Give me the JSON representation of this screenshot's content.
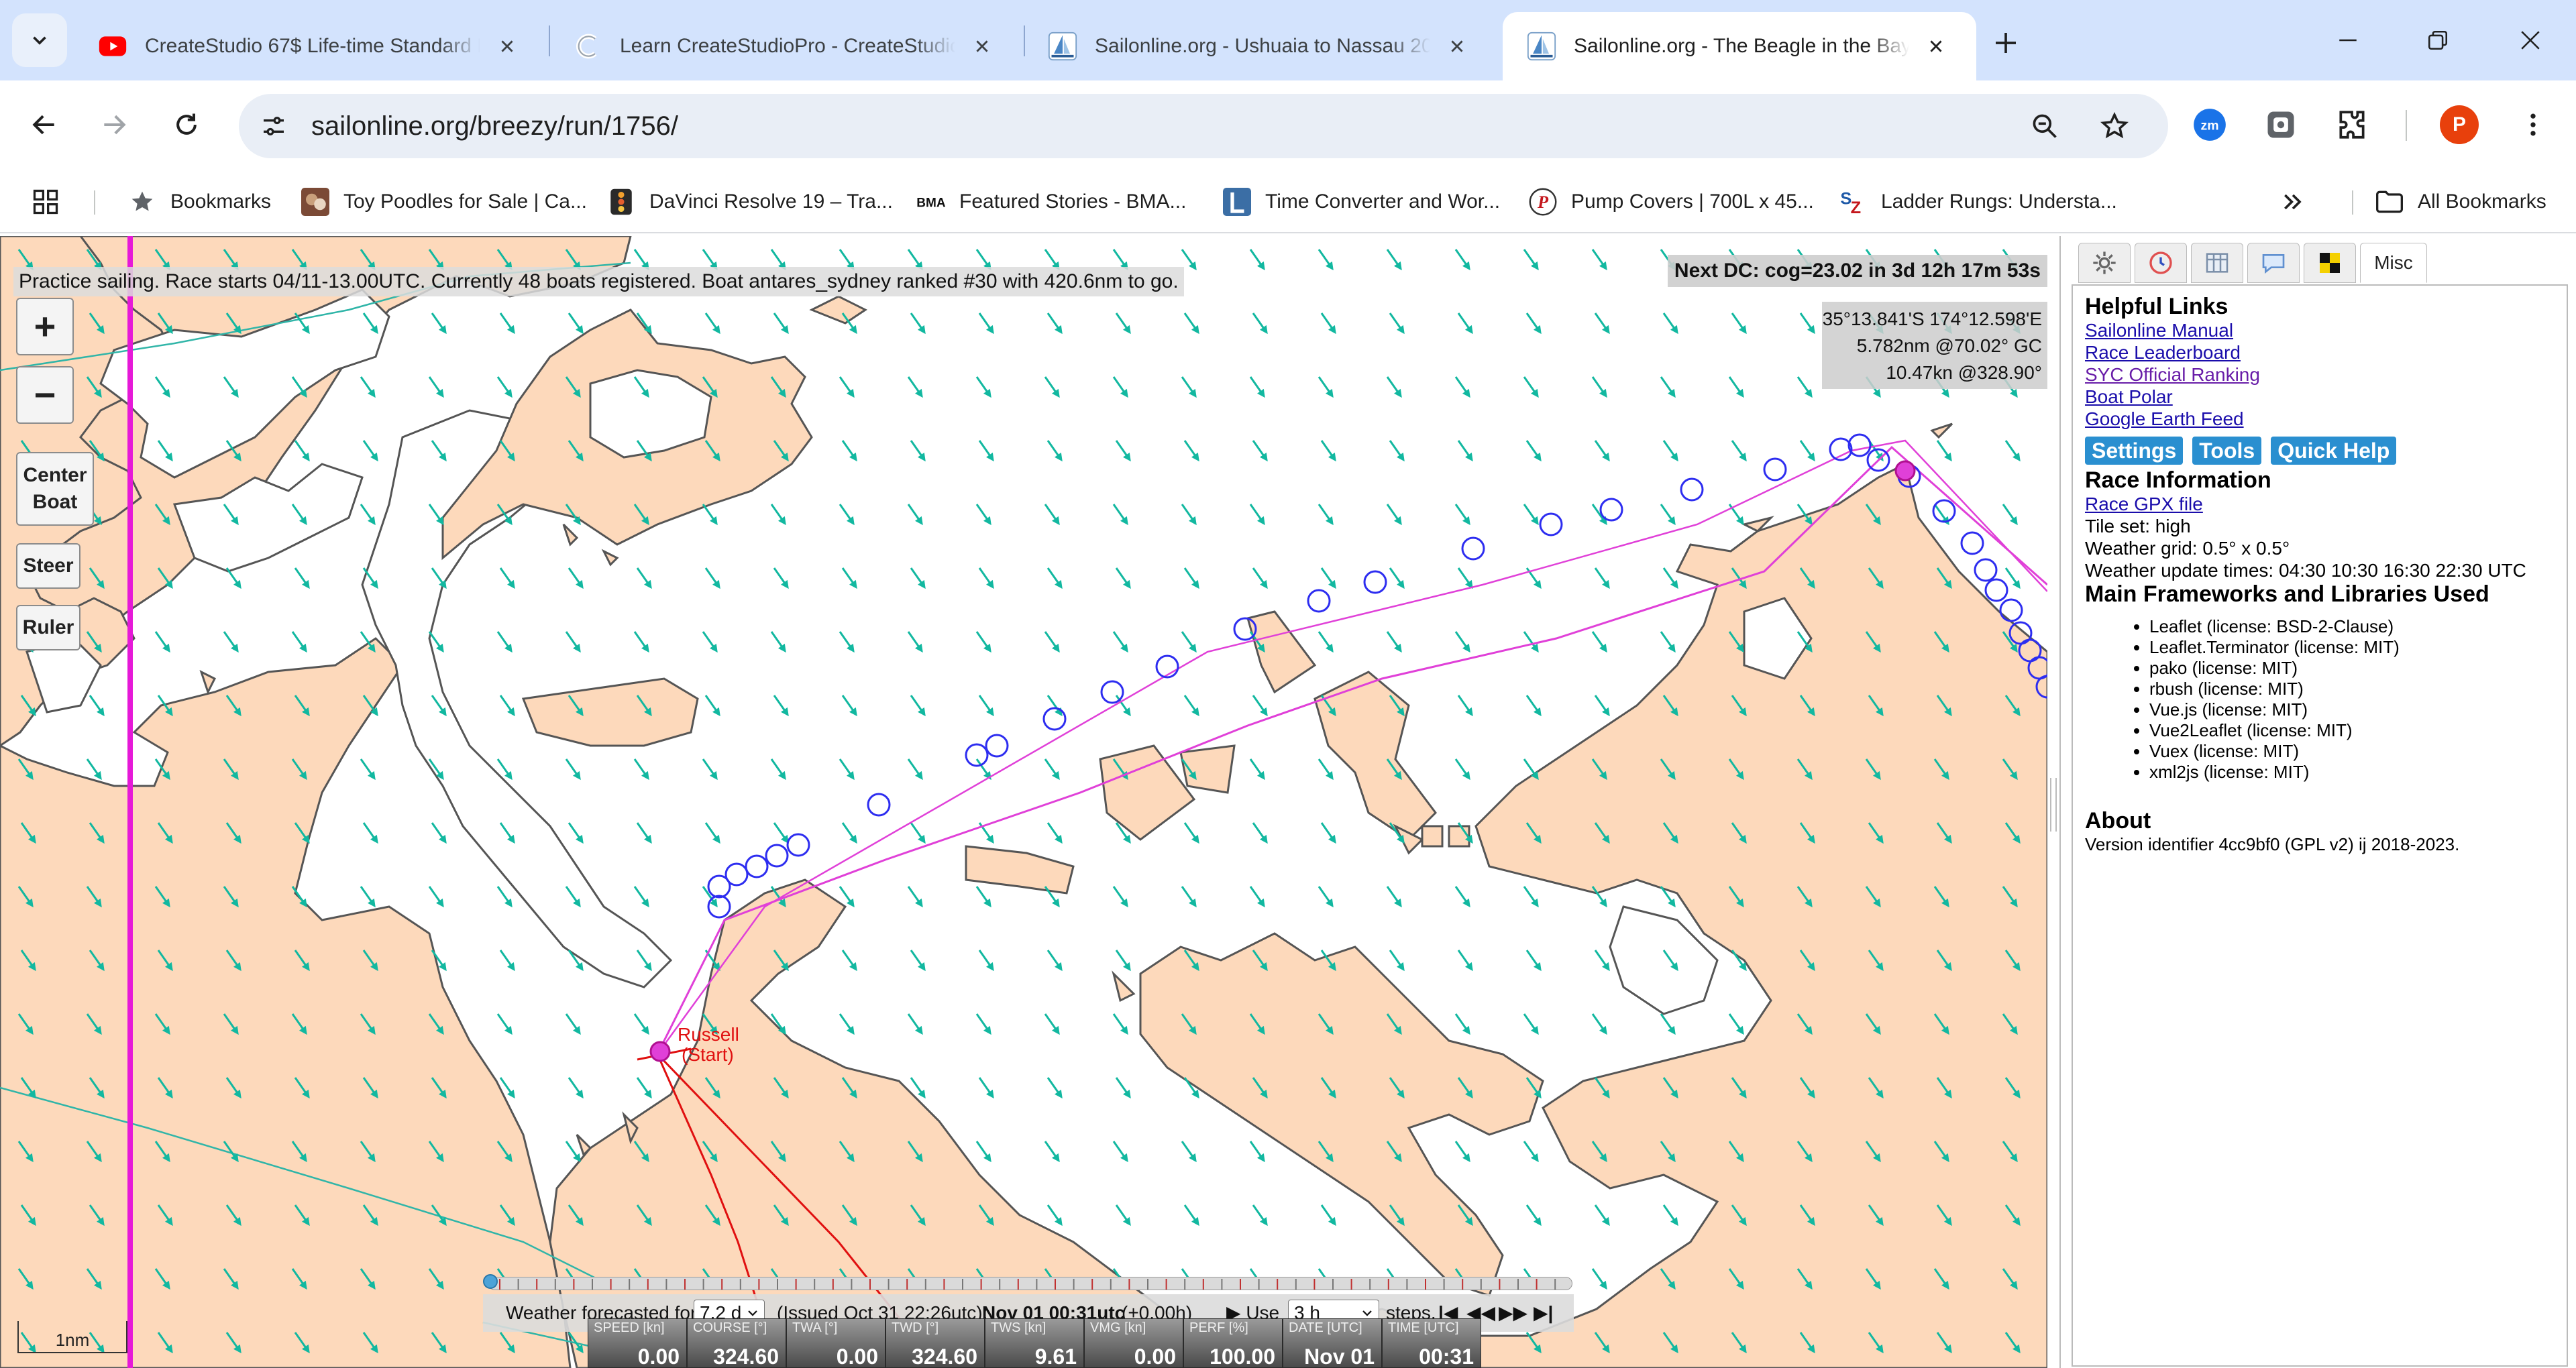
{
  "browser": {
    "tabs": [
      {
        "title": "CreateStudio 67$ Life-time Standard P",
        "favicon": "youtube-icon"
      },
      {
        "title": "Learn CreateStudioPro - CreateStudio",
        "favicon": "createstudio-icon"
      },
      {
        "title": "Sailonline.org - Ushuaia to Nassau 20",
        "favicon": "sailonline-icon"
      },
      {
        "title": "Sailonline.org - The Beagle in the Bay",
        "favicon": "sailonline-icon",
        "active": true
      }
    ],
    "url": "sailonline.org/breezy/run/1756/",
    "profile_initial": "P",
    "extensions": [
      "zoom-extension-icon",
      "extension-icon",
      "puzzle-icon"
    ]
  },
  "bookmarks": {
    "items": [
      {
        "label": "Bookmarks",
        "icon": "star-icon"
      },
      {
        "label": "Toy Poodles for Sale | Ca...",
        "icon": "poodle-icon"
      },
      {
        "label": "DaVinci Resolve 19 – Tra...",
        "icon": "davinci-icon"
      },
      {
        "label": "Featured Stories - BMA...",
        "icon": "bma-icon"
      },
      {
        "label": "Time Converter and Wor...",
        "icon": "clock-icon"
      },
      {
        "label": "Pump Covers | 700L x 45...",
        "icon": "pump-icon"
      },
      {
        "label": "Ladder Rungs: Understa...",
        "icon": "sz-icon"
      }
    ],
    "all_label": "All Bookmarks"
  },
  "map": {
    "status": "Practice sailing. Race starts 04/11-13.00UTC. Currently 48 boats registered. Boat antares_sydney ranked #30 with 420.6nm to go.",
    "next_dc": "Next DC: cog=23.02 in 3d 12h 17m 53s",
    "coords": [
      "35°13.841'S 174°12.598'E",
      "5.782nm @70.02° GC",
      "10.47kn @328.90°"
    ],
    "controls": {
      "zoom_in": "+",
      "zoom_out": "−",
      "center_boat": "Center Boat",
      "steer": "Steer",
      "ruler": "Ruler"
    },
    "start_label": [
      "Russell",
      "(Start)"
    ],
    "scale": "1nm",
    "colors": {
      "land": "#fdd9bb",
      "water": "#ffffff",
      "wind_arrow": "#12b8a0",
      "route": "#e040d8",
      "waypoint": "#2d2df0",
      "track": "#e01010"
    }
  },
  "forecast": {
    "label": "Weather forecasted for",
    "range": "7.2 d",
    "issued": "(Issued Oct 31 22:26utc):",
    "time": "Nov 01 00:31utc",
    "offset": "(+0.00h)",
    "use_label": "▶ Use",
    "step": "3 h",
    "steps_label": "steps.",
    "transport": [
      "|◀",
      "◀◀",
      "▶▶",
      "▶|"
    ]
  },
  "instruments": [
    {
      "label": "SPEED [kn]",
      "value": "0.00"
    },
    {
      "label": "COURSE [°]",
      "value": "324.60"
    },
    {
      "label": "TWA [°]",
      "value": "0.00"
    },
    {
      "label": "TWD [°]",
      "value": "324.60"
    },
    {
      "label": "TWS [kn]",
      "value": "9.61"
    },
    {
      "label": "VMG [kn]",
      "value": "0.00"
    },
    {
      "label": "PERF [%]",
      "value": "100.00"
    },
    {
      "label": "DATE [UTC]",
      "value": "Nov 01"
    },
    {
      "label": "TIME [UTC]",
      "value": "00:31"
    }
  ],
  "panel": {
    "tabs": [
      "weather-icon",
      "clock-icon",
      "fleet-icon",
      "chat-icon",
      "flag-icon"
    ],
    "active_tab": "Misc",
    "helpful_title": "Helpful Links",
    "links": [
      "Sailonline Manual",
      "Race Leaderboard",
      "SYC Official Ranking",
      "Boat Polar",
      "Google Earth Feed"
    ],
    "buttons": [
      "Settings",
      "Tools",
      "Quick Help"
    ],
    "race_title": "Race Information",
    "race_gpx": "Race GPX file",
    "tile_set": "Tile set: high",
    "weather_grid": "Weather grid: 0.5° x 0.5°",
    "update_times": "Weather update times: 04:30 10:30 16:30 22:30 UTC",
    "fw_title": "Main Frameworks and Libraries Used",
    "libs": [
      "Leaflet (license: BSD-2-Clause)",
      "Leaflet.Terminator (license: MIT)",
      "pako (license: MIT)",
      "rbush (license: MIT)",
      "Vue.js (license: MIT)",
      "Vue2Leaflet (license: MIT)",
      "Vuex (license: MIT)",
      "xml2js (license: MIT)"
    ],
    "about_title": "About",
    "about_text": "Version identifier 4cc9bf0 (GPL v2) ij 2018-2023."
  }
}
